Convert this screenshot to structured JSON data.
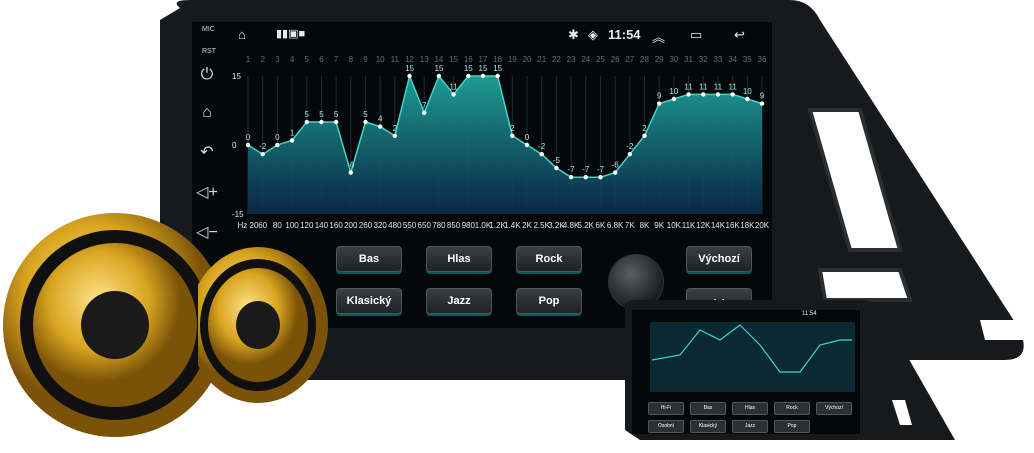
{
  "status": {
    "time": "11:54",
    "left_icons": [
      "home-outline-icon",
      "person-icon",
      "person-icon",
      "photo-icon",
      "square-icon"
    ],
    "right_icons": [
      "bluetooth-icon",
      "wifi-icon",
      "chevron-up-double-icon",
      "recent-apps-icon",
      "back-icon"
    ]
  },
  "side_labels": {
    "mic": "MIC",
    "rst": "RST"
  },
  "side_buttons": [
    "power-icon",
    "home-icon",
    "back-icon",
    "volume-up-icon",
    "volume-down-icon"
  ],
  "eq": {
    "bands": [
      "1",
      "2",
      "3",
      "4",
      "5",
      "6",
      "7",
      "8",
      "9",
      "10",
      "11",
      "12",
      "13",
      "14",
      "15",
      "16",
      "17",
      "18",
      "19",
      "20",
      "21",
      "22",
      "23",
      "24",
      "25",
      "26",
      "27",
      "28",
      "29",
      "30",
      "31",
      "32",
      "33",
      "34",
      "35",
      "36"
    ],
    "freq_labels": [
      "Hz 20",
      "60",
      "80",
      "100",
      "120",
      "140",
      "160",
      "200",
      "260",
      "320",
      "480",
      "550",
      "650",
      "780",
      "850",
      "980",
      "1.0K",
      "1.2K",
      "1.4K",
      "2K",
      "2.5K",
      "3.2K",
      "4.8K",
      "5.2K",
      "6K",
      "6.8K",
      "7K",
      "8K",
      "9K",
      "10K",
      "11K",
      "12K",
      "14K",
      "16K",
      "18K",
      "20K"
    ],
    "y_axis": {
      "max_label": "15",
      "mid_label": "0",
      "min_label": "-15"
    },
    "values": [
      0,
      -2,
      0,
      1,
      5,
      5,
      5,
      -6,
      5,
      4,
      2,
      15,
      7,
      15,
      11,
      15,
      15,
      15,
      2,
      0,
      -2,
      -5,
      -7,
      -7,
      -7,
      -6,
      -2,
      2,
      9,
      10,
      11,
      11,
      11,
      11,
      10,
      9
    ],
    "value_labels": [
      "0",
      "-2",
      "0",
      "1",
      "5",
      "5",
      "5",
      "-6",
      "5",
      "4",
      "2",
      "15",
      "7",
      "15",
      "11",
      "15",
      "15",
      "15",
      "2",
      "0",
      "-2",
      "-5",
      "-7",
      "-7",
      "-7",
      "-6",
      "-2",
      "2",
      "9",
      "10",
      "11",
      "11",
      "11",
      "11",
      "10",
      "9"
    ],
    "accent": "#3fd6c8"
  },
  "presets": {
    "row1": [
      "Bas",
      "Hlas",
      "Rock",
      "Výchozí"
    ],
    "row2": [
      "Klasický",
      "Jazz",
      "Pop"
    ],
    "colors": {
      "button_glow": "#20e0d0"
    }
  },
  "thumb": {
    "time": "11:54",
    "row1": [
      "Hi-Fi",
      "Bas",
      "Hlas",
      "Rock",
      "Výchozí"
    ],
    "row2": [
      "Osobní",
      "Klasický",
      "Jazz",
      "Pop"
    ]
  },
  "colors": {
    "speaker_gold": "#d9a520",
    "bezel": "#1c1f22"
  }
}
